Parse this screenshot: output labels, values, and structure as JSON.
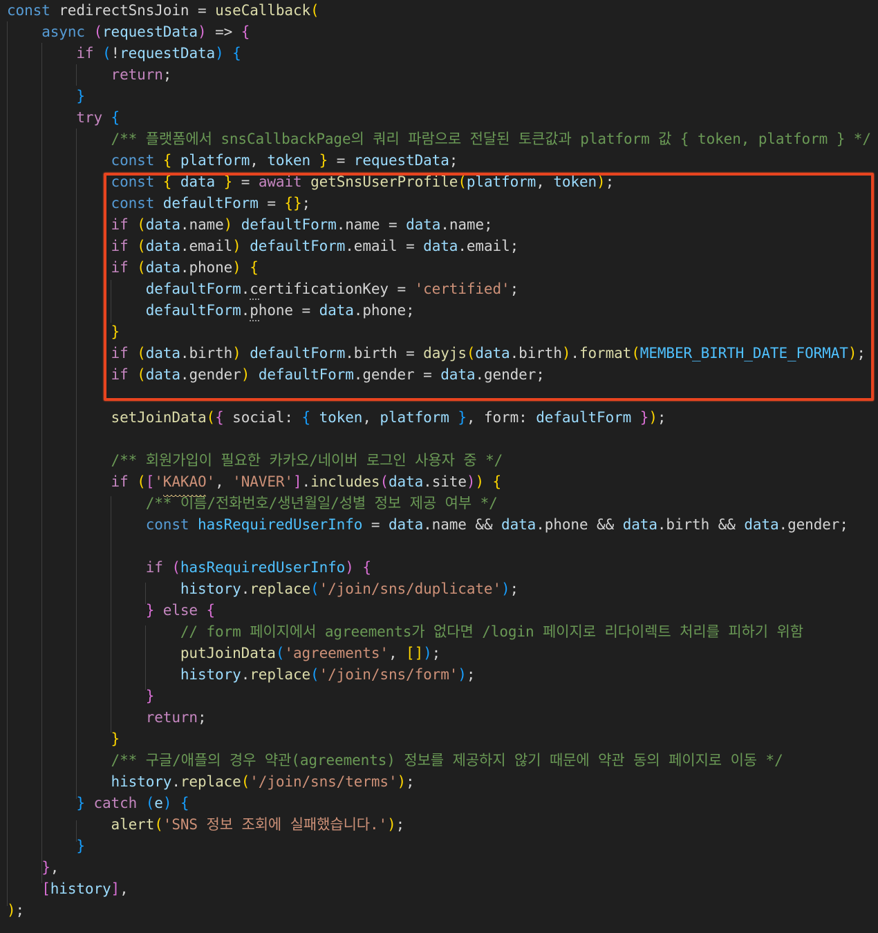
{
  "editor": {
    "language": "javascript",
    "highlight_color": "#e8441f",
    "lines": [
      "const redirectSnsJoin = useCallback(",
      "    async (requestData) => {",
      "        if (!requestData) {",
      "            return;",
      "        }",
      "        try {",
      "            /** 플랫폼에서 snsCallbackPage의 쿼리 파람으로 전달된 토큰값과 platform 값 { token, platform } */",
      "            const { platform, token } = requestData;",
      "            const { data } = await getSnsUserProfile(platform, token);",
      "            const defaultForm = {};",
      "            if (data.name) defaultForm.name = data.name;",
      "            if (data.email) defaultForm.email = data.email;",
      "            if (data.phone) {",
      "                defaultForm.certificationKey = 'certified';",
      "                defaultForm.phone = data.phone;",
      "            }",
      "            if (data.birth) defaultForm.birth = dayjs(data.birth).format(MEMBER_BIRTH_DATE_FORMAT);",
      "            if (data.gender) defaultForm.gender = data.gender;",
      "",
      "            setJoinData({ social: { token, platform }, form: defaultForm });",
      "",
      "            /** 회원가입이 필요한 카카오/네이버 로그인 사용자 중 */",
      "            if (['KAKAO', 'NAVER'].includes(data.site)) {",
      "                /** 이름/전화번호/생년월일/성별 정보 제공 여부 */",
      "                const hasRequiredUserInfo = data.name && data.phone && data.birth && data.gender;",
      "",
      "                if (hasRequiredUserInfo) {",
      "                    history.replace('/join/sns/duplicate');",
      "                } else {",
      "                    // form 페이지에서 agreements가 없다면 /login 페이지로 리다이렉트 처리를 피하기 위함",
      "                    putJoinData('agreements', []);",
      "                    history.replace('/join/sns/form');",
      "                }",
      "                return;",
      "            }",
      "            /** 구글/애플의 경우 약관(agreements) 정보를 제공하지 않기 때문에 약관 동의 페이지로 이동 */",
      "            history.replace('/join/sns/terms');",
      "        } catch (e) {",
      "            alert('SNS 정보 조회에 실패했습니다.');",
      "        }",
      "    },",
      "    [history],",
      ");"
    ]
  }
}
